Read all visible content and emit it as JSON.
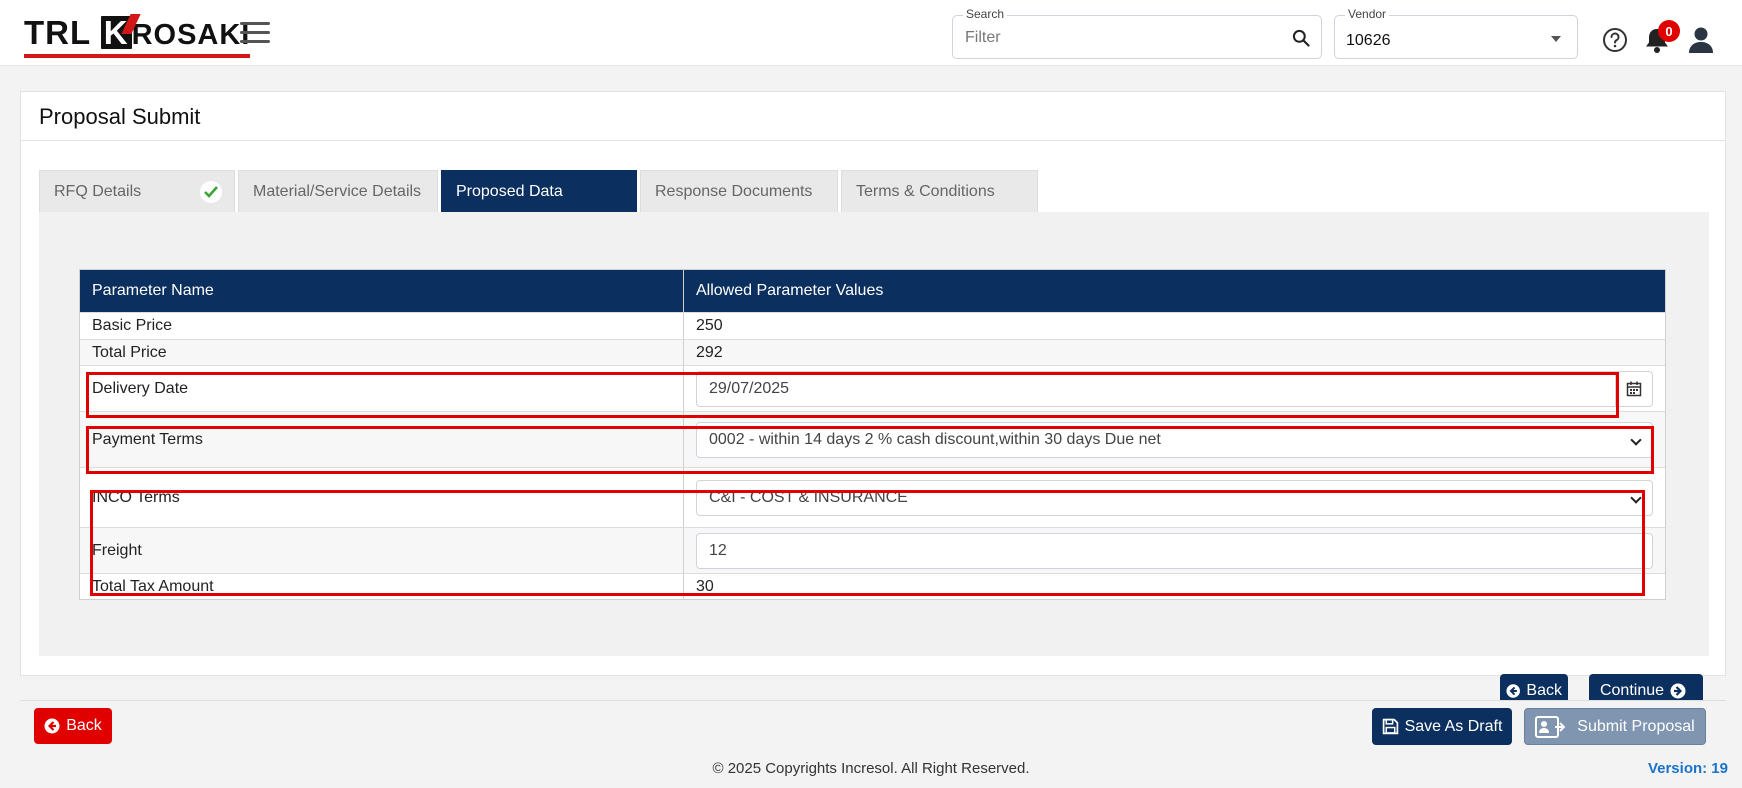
{
  "header": {
    "logo_text_1": "TRL",
    "logo_k": "K",
    "logo_text_2": "ROSAKI",
    "search_label": "Search",
    "search_placeholder": "Filter",
    "vendor_label": "Vendor",
    "vendor_value": "10626",
    "notification_count": "0"
  },
  "card": {
    "title": "Proposal Submit"
  },
  "tabs": [
    {
      "label": "RFQ Details",
      "completed": true
    },
    {
      "label": "Material/Service Details",
      "completed": false
    },
    {
      "label": "Proposed Data",
      "completed": false,
      "active": true
    },
    {
      "label": "Response Documents",
      "completed": false
    },
    {
      "label": "Terms & Conditions",
      "completed": false
    }
  ],
  "table": {
    "headers": [
      "Parameter Name",
      "Allowed Parameter Values"
    ],
    "rows": [
      {
        "name": "Basic Price",
        "value": "250"
      },
      {
        "name": "Total Price",
        "value": "292"
      },
      {
        "name": "Delivery Date",
        "value": "29/07/2025"
      },
      {
        "name": "Payment Terms",
        "value": "0002 - within 14 days 2 % cash discount,within 30 days Due net"
      },
      {
        "name": "INCO Terms",
        "value": "C&I - COST & INSURANCE"
      },
      {
        "name": "Freight",
        "value": "12"
      },
      {
        "name": "Total Tax Amount",
        "value": "30"
      }
    ]
  },
  "buttons": {
    "inner_back": "Back",
    "continue": "Continue",
    "footer_back": "Back",
    "save_draft": "Save As Draft",
    "submit": "Submit Proposal"
  },
  "footer": {
    "copyright": "© 2025 Copyrights Incresol. All Right Reserved.",
    "version": "Version: 19"
  },
  "colors": {
    "navy": "#0b2f5e",
    "danger": "#e00000",
    "highlight": "#e00000",
    "submit_disabled": "#7f95b0",
    "version_blue": "#1a73c9"
  }
}
